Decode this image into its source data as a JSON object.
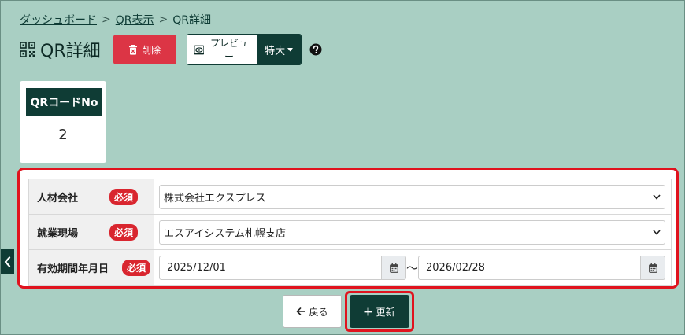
{
  "breadcrumb": {
    "dashboard": "ダッシュボード",
    "qr_list": "QR表示",
    "current": "QR詳細",
    "separator": ">"
  },
  "page": {
    "title": "QR詳細"
  },
  "toolbar": {
    "delete_label": "削除",
    "preview_label": "プレビュー",
    "size_label": "特大"
  },
  "qr_card": {
    "header": "QRコードNo",
    "value": "2"
  },
  "form": {
    "required_badge": "必須",
    "rows": [
      {
        "label": "人材会社",
        "value": "株式会社エクスプレス"
      },
      {
        "label": "就業現場",
        "value": "エスアイシステム札幌支店"
      },
      {
        "label": "有効期間年月日",
        "start": "2025/12/01",
        "end": "2026/02/28",
        "tilde": "〜"
      }
    ]
  },
  "actions": {
    "back_label": "戻る",
    "update_label": "更新"
  },
  "colors": {
    "background": "#a9cfc3",
    "primary": "#0f3c35",
    "danger": "#dc3545",
    "highlight": "#e0131e"
  }
}
